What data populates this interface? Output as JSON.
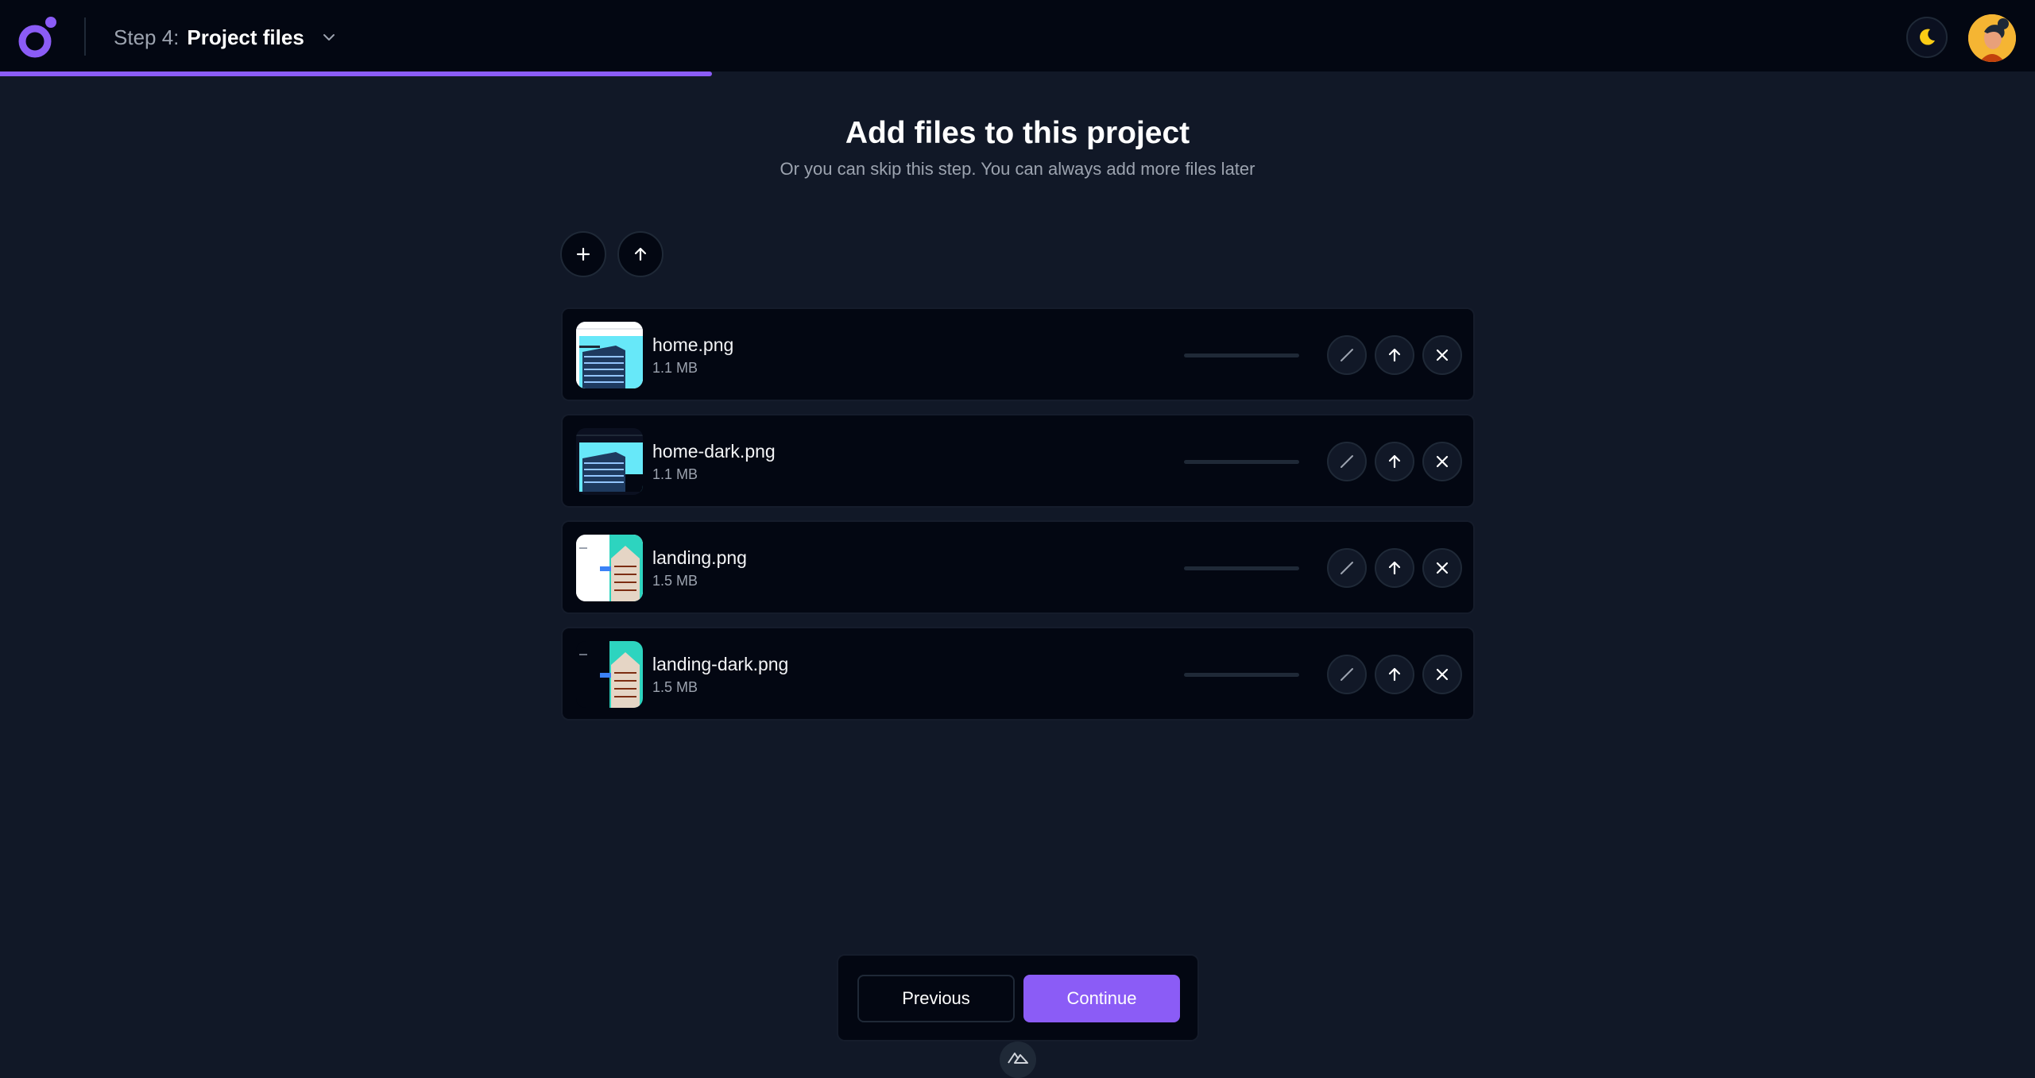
{
  "header": {
    "step_prefix": "Step 4:",
    "step_name": "Project files",
    "progress_fraction": 0.35,
    "accent_color": "#8b5cf6"
  },
  "icons": {
    "logo": "logo-ring-dot",
    "step_menu": "chevron-down-icon",
    "theme": "moon-icon",
    "add": "plus-icon",
    "upload": "arrow-up-icon",
    "crop": "slash-icon",
    "remove": "close-icon",
    "devtools": "nuxt-icon"
  },
  "page": {
    "title": "Add files to this project",
    "subtitle": "Or you can skip this step. You can always add more files later"
  },
  "files": [
    {
      "name": "home.png",
      "size": "1.1 MB",
      "upload_progress": 0,
      "thumb": "light"
    },
    {
      "name": "home-dark.png",
      "size": "1.1 MB",
      "upload_progress": 0,
      "thumb": "dark"
    },
    {
      "name": "landing.png",
      "size": "1.5 MB",
      "upload_progress": 0,
      "thumb": "landing-light"
    },
    {
      "name": "landing-dark.png",
      "size": "1.5 MB",
      "upload_progress": 0,
      "thumb": "landing-dark"
    }
  ],
  "footer": {
    "previous_label": "Previous",
    "continue_label": "Continue"
  }
}
